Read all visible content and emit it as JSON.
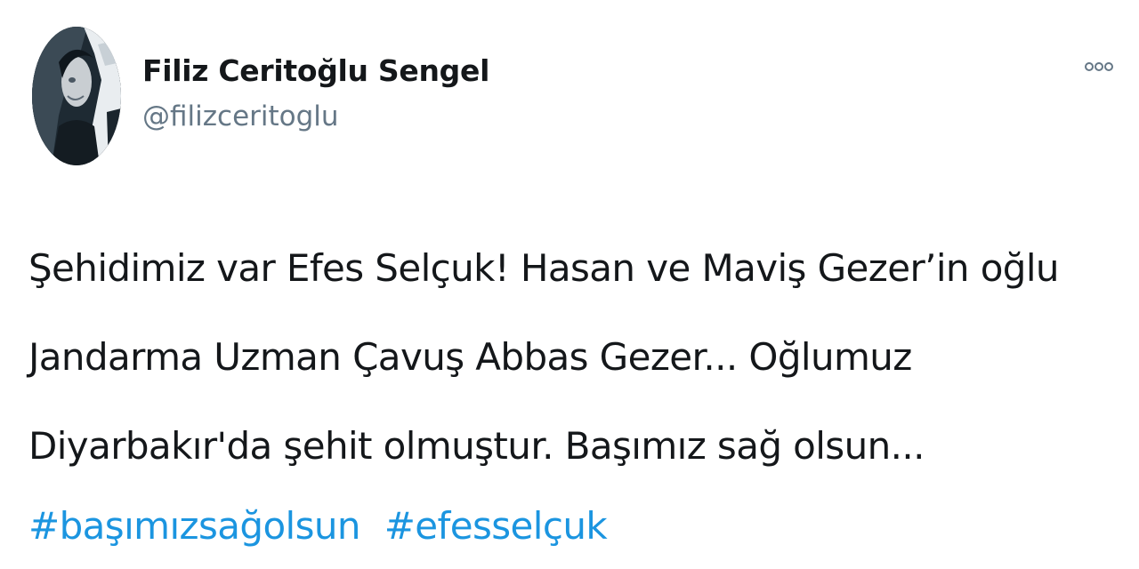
{
  "tweet": {
    "author": {
      "display_name": "Filiz Ceritoğlu Sengel",
      "handle": "@filizceritoglu",
      "avatar_icon": "profile-photo"
    },
    "more_icon": "more-options-icon",
    "text_lines": [
      "Şehidimiz var Efes Selçuk! Hasan ve Maviş Gezer’in oğlu",
      "Jandarma Uzman Çavuş Abbas Gezer... Oğlumuz",
      "Diyarbakır'da şehit olmuştur. Başımız sağ olsun..."
    ],
    "hashtags": [
      "#başımızsağolsun",
      "#efesselçuk"
    ]
  },
  "colors": {
    "text": "#14171a",
    "secondary_text": "#657786",
    "link": "#1b95e0",
    "background": "#ffffff"
  }
}
